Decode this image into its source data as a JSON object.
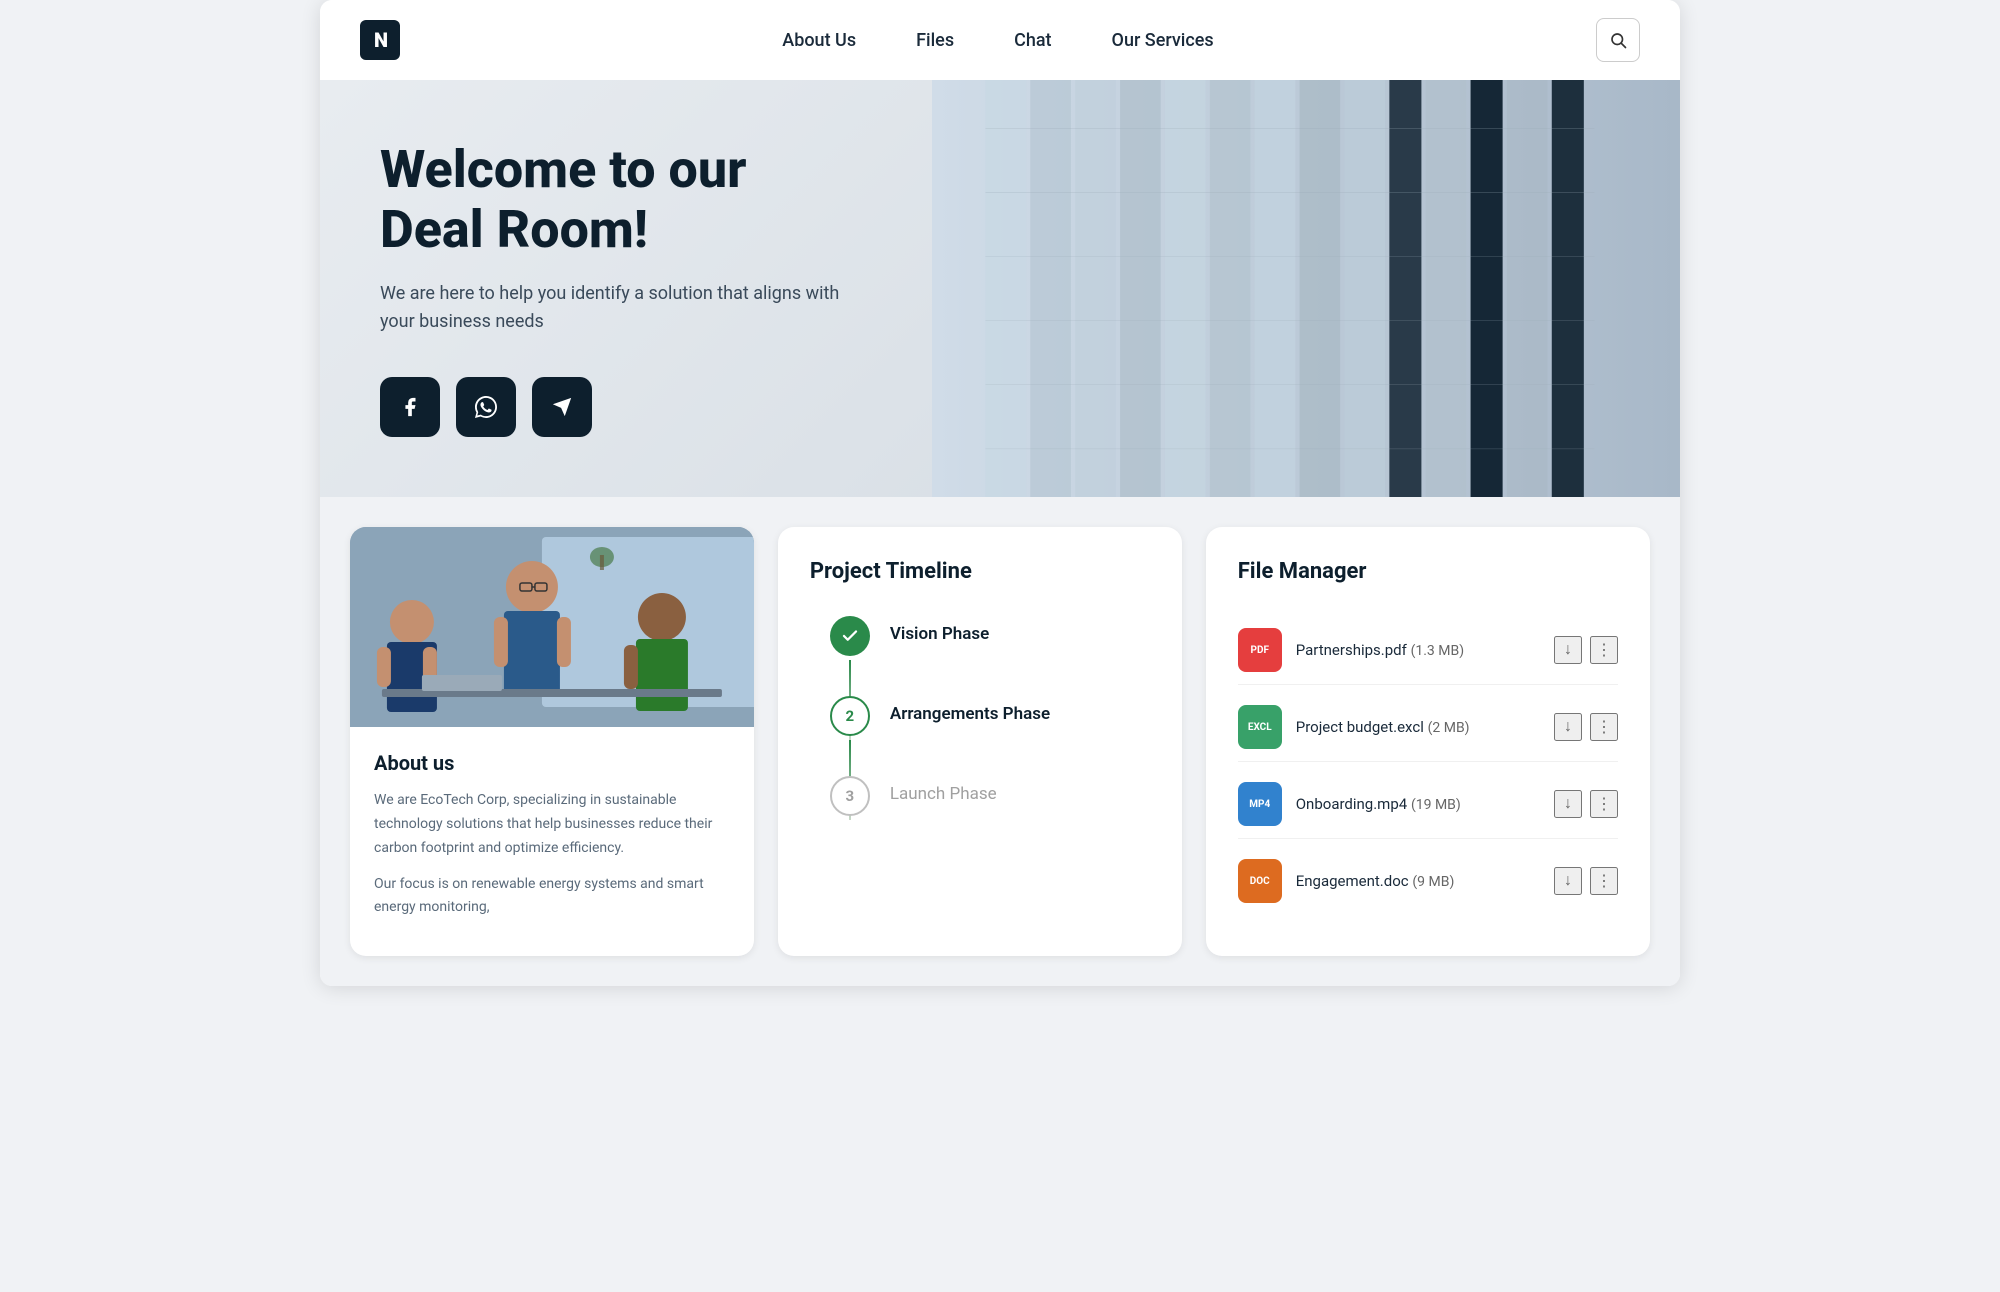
{
  "brand": {
    "logo_text": "N",
    "logo_alt": "Brand Logo"
  },
  "nav": {
    "links": [
      {
        "id": "about-us",
        "label": "About Us",
        "href": "#"
      },
      {
        "id": "files",
        "label": "Files",
        "href": "#"
      },
      {
        "id": "chat",
        "label": "Chat",
        "href": "#"
      },
      {
        "id": "our-services",
        "label": "Our Services",
        "href": "#"
      }
    ],
    "search_placeholder": "Search"
  },
  "hero": {
    "title": "Welcome to our Deal Room!",
    "subtitle": "We are here to help you identify a solution that aligns with your business needs",
    "buttons": [
      {
        "id": "facebook",
        "icon": "f",
        "label": "Facebook"
      },
      {
        "id": "whatsapp",
        "icon": "☎",
        "label": "WhatsApp"
      },
      {
        "id": "telegram",
        "icon": "✈",
        "label": "Telegram"
      }
    ]
  },
  "about_card": {
    "title": "About us",
    "paragraph1": "We are EcoTech Corp, specializing in sustainable technology solutions that help businesses reduce their carbon footprint and optimize efficiency.",
    "paragraph2": "Our focus is on renewable energy systems and smart energy monitoring,"
  },
  "timeline_card": {
    "title": "Project Timeline",
    "items": [
      {
        "number": "✓",
        "label": "Vision Phase",
        "state": "completed"
      },
      {
        "number": "2",
        "label": "Arrangements Phase",
        "state": "active"
      },
      {
        "number": "3",
        "label": "Launch Phase",
        "state": "inactive"
      }
    ]
  },
  "file_manager": {
    "title": "File Manager",
    "files": [
      {
        "badge": "PDF",
        "badge_class": "badge-pdf",
        "name": "Partnerships.pdf",
        "size": "(1.3 MB)"
      },
      {
        "badge": "EXCL",
        "badge_class": "badge-excl",
        "name": "Project budget.excl",
        "size": "(2 MB)"
      },
      {
        "badge": "MP4",
        "badge_class": "badge-mp4",
        "name": "Onboarding.mp4",
        "size": "(19 MB)"
      },
      {
        "badge": "DOC",
        "badge_class": "badge-doc",
        "name": "Engagement.doc",
        "size": "(9 MB)"
      }
    ]
  },
  "icons": {
    "search": "🔍",
    "download": "↓",
    "more": "⋮",
    "check": "✓",
    "facebook": "f",
    "whatsapp": "☎",
    "telegram": "✈"
  }
}
